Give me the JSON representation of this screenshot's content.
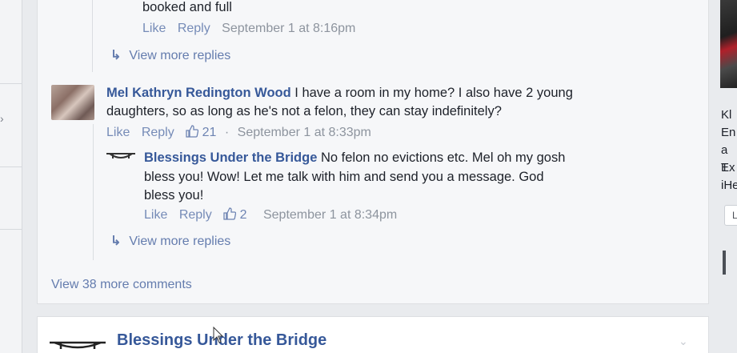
{
  "comments": {
    "top_fragment": {
      "text": "booked and full",
      "like": "Like",
      "reply": "Reply",
      "timestamp": "September 1 at 8:16pm",
      "view_more": "View more replies"
    },
    "mel": {
      "author": "Mel Kathryn Redington Wood",
      "text_line1": " I have a room in my home? I also have 2 young",
      "text_line2": "daughters, so as long as he's not a felon, they can stay indefinitely?",
      "like": "Like",
      "reply": "Reply",
      "reactions": "21",
      "timestamp": "September 1 at 8:33pm"
    },
    "bridge_reply": {
      "author": "Blessings Under the Bridge",
      "text_line1": " No felon no evictions etc. Mel oh my gosh",
      "text_line2": "bless you! Wow! Let me talk with him and send you a message. God",
      "text_line3": "bless you!",
      "like": "Like",
      "reply": "Reply",
      "reactions": "2",
      "timestamp": "September 1 at 8:34pm",
      "view_more": "View more replies"
    },
    "view_more_comments": "View 38 more comments"
  },
  "next_post": {
    "author": "Blessings Under the Bridge"
  },
  "right_column": {
    "lines": [
      "Kl",
      "En",
      "a T",
      "Ex",
      "iHe"
    ],
    "button_label": "L"
  },
  "icons": {
    "reply_arrow": "reply-arrow-icon",
    "like": "thumbs-up-icon",
    "chevron": "chevron-down-icon"
  },
  "colors": {
    "link_blue": "#365899",
    "meta_gray": "#8d949e",
    "background": "#e9ebee"
  }
}
